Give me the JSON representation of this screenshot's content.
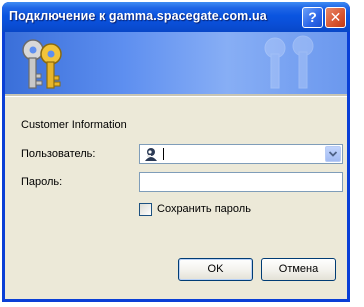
{
  "window": {
    "title": "Подключение к gamma.spacegate.com.ua",
    "help_glyph": "?",
    "close_glyph": "✕"
  },
  "form": {
    "customer_info": "Customer Information",
    "user_label": "Пользователь:",
    "user_value": "",
    "password_label": "Пароль:",
    "password_value": "",
    "remember_label": "Сохранить пароль",
    "remember_checked": false
  },
  "buttons": {
    "ok": "OK",
    "cancel": "Отмена"
  },
  "icons": [
    "keys-icon",
    "user-icon",
    "chevron-down-icon"
  ],
  "colors": {
    "titlebar": "#0a55e0",
    "dialog_bg": "#ece9d8",
    "field_border": "#7f9db9",
    "close_button": "#d8552f"
  }
}
